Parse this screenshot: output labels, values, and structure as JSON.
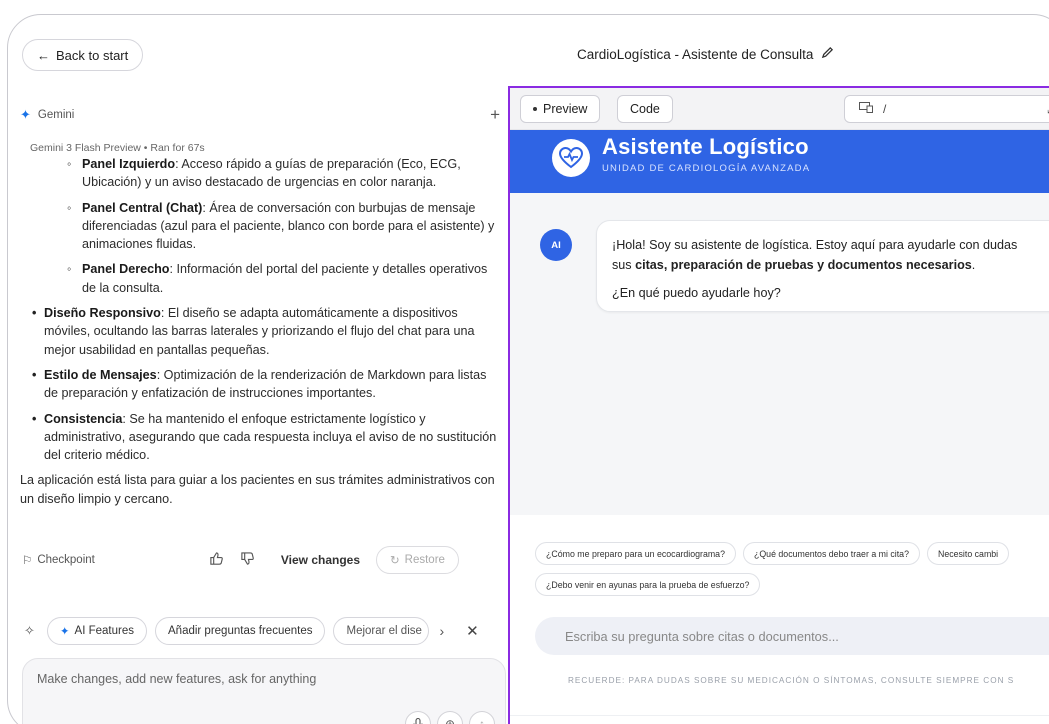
{
  "topbar": {
    "back_label": "Back to start",
    "title": "CardioLogística - Asistente de Consulta"
  },
  "left": {
    "header_label": "Gemini",
    "model_line": "Gemini 3 Flash Preview • Ran for 67s",
    "sub_items": [
      {
        "bold": "Panel Izquierdo",
        "text": ": Acceso rápido a guías de preparación (Eco, ECG, Ubicación) y un aviso destacado de urgencias en color naranja."
      },
      {
        "bold": "Panel Central (Chat)",
        "text": ": Área de conversación con burbujas de mensaje diferenciadas (azul para el paciente, blanco con borde para el asistente) y animaciones fluidas."
      },
      {
        "bold": "Panel Derecho",
        "text": ": Información del portal del paciente y detalles operativos de la consulta."
      }
    ],
    "main_items": [
      {
        "bold": "Diseño Responsivo",
        "text": ": El diseño se adapta automáticamente a dispositivos móviles, ocultando las barras laterales y priorizando el flujo del chat para una mejor usabilidad en pantallas pequeñas."
      },
      {
        "bold": "Estilo de Mensajes",
        "text": ": Optimización de la renderización de Markdown para listas de preparación y enfatización de instrucciones importantes."
      },
      {
        "bold": "Consistencia",
        "text": ": Se ha mantenido el enfoque estrictamente logístico y administrativo, asegurando que cada respuesta incluya el aviso de no sustitución del criterio médico."
      }
    ],
    "final_paragraph": "La aplicación está lista para guiar a los pacientes en sus trámites administrativos con un diseño limpio y cercano.",
    "checkpoint_label": "Checkpoint",
    "view_changes_label": "View changes",
    "restore_label": "Restore",
    "chips": [
      "AI Features",
      "Añadir preguntas frecuentes",
      "Mejorar el dise"
    ],
    "prompt_placeholder": "Make changes, add new features, ask for anything"
  },
  "right": {
    "tab_preview": "Preview",
    "tab_code": "Code",
    "url_path": "/",
    "app": {
      "title": "Asistente Logístico",
      "subtitle": "UNIDAD DE CARDIOLOGÍA AVANZADA",
      "avatar_label": "AI",
      "bubble_line1": "¡Hola! Soy su asistente de logística. Estoy aquí para ayudarle con dudas",
      "bubble_line2_prefix": "sus ",
      "bubble_line2_bold": "citas, preparación de pruebas y documentos necesarios",
      "bubble_line2_suffix": ".",
      "bubble_question": "¿En qué puedo ayudarle hoy?",
      "suggestions_row1": [
        "¿Cómo me preparo para un ecocardiograma?",
        "¿Qué documentos debo traer a mi cita?",
        "Necesito cambi"
      ],
      "suggestions_row2": [
        "¿Debo venir en ayunas para la prueba de esfuerzo?"
      ],
      "input_placeholder": "Escriba su pregunta sobre citas o documentos...",
      "disclaimer": "RECUERDE: PARA DUDAS SOBRE SU MEDICACIÓN O SÍNTOMAS, CONSULTE SIEMPRE CON S"
    }
  },
  "colors": {
    "accent_blue": "#2f64e4",
    "preview_border": "#8a2be2",
    "gemini_star": "#1a73e8"
  }
}
